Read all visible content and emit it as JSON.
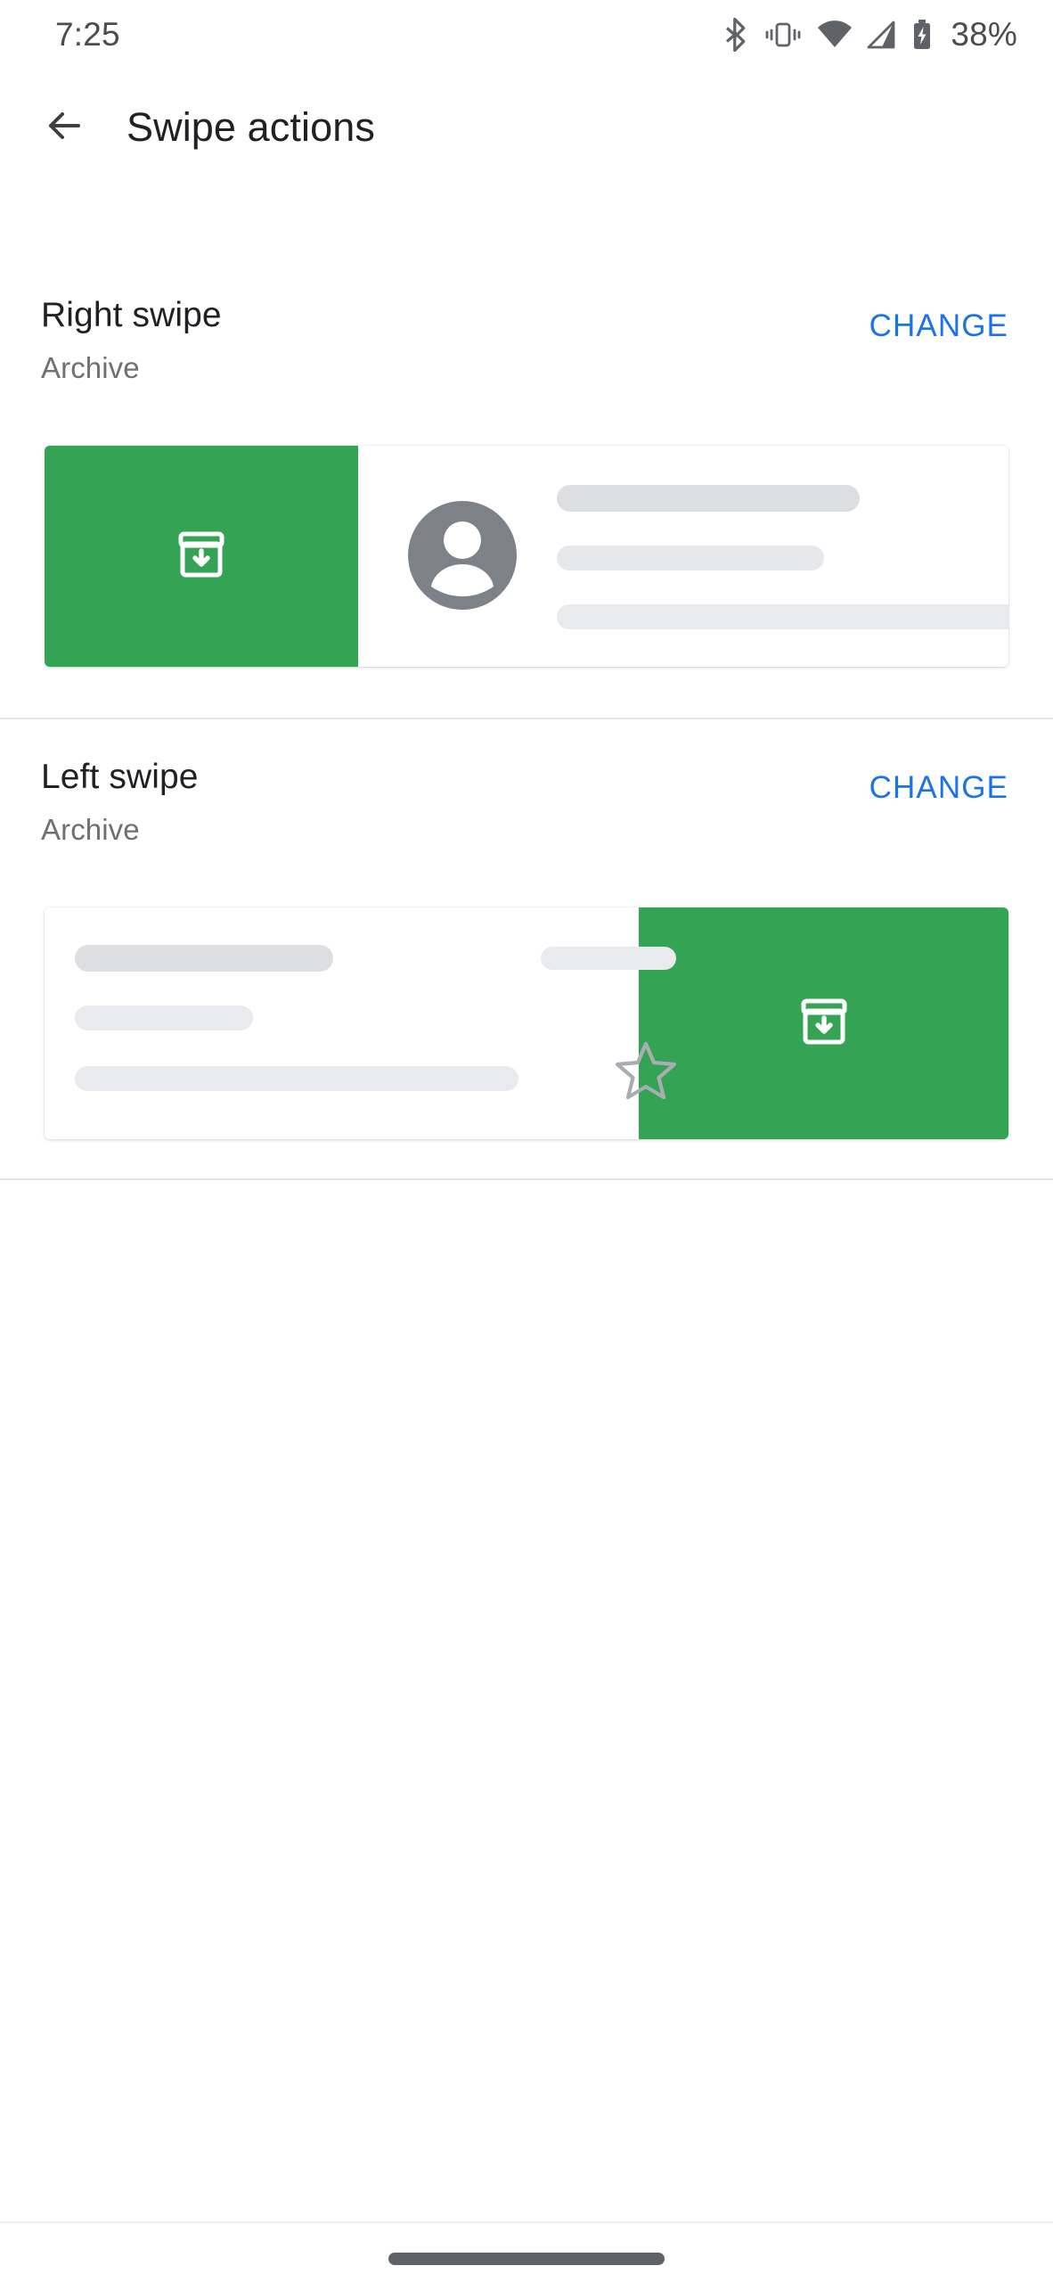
{
  "status_bar": {
    "time": "7:25",
    "battery_percent": "38%",
    "icons": [
      "bluetooth-icon",
      "vibrate-icon",
      "wifi-icon",
      "cell-signal-icon",
      "battery-charging-icon"
    ]
  },
  "app_bar": {
    "back_icon": "back-arrow-icon",
    "title": "Swipe actions"
  },
  "sections": [
    {
      "title": "Right swipe",
      "subtitle": "Archive",
      "change_label": "CHANGE",
      "action_icon": "archive-icon",
      "action_color": "#34a353",
      "direction": "right"
    },
    {
      "title": "Left swipe",
      "subtitle": "Archive",
      "change_label": "CHANGE",
      "action_icon": "archive-icon",
      "action_color": "#34a353",
      "direction": "left"
    }
  ],
  "preview_right": {
    "avatar_icon": "person-avatar-icon",
    "placeholder_bars": [
      "sender-line",
      "subject-line",
      "snippet-line"
    ]
  },
  "preview_left": {
    "star_icon": "star-outline-icon",
    "placeholder_bars": [
      "sender-line",
      "timestamp-line",
      "subject-line",
      "snippet-line"
    ]
  },
  "colors": {
    "accent_blue": "#1a73e8",
    "archive_green": "#34a353",
    "title_text": "#202124",
    "subtitle_text": "#6d7174",
    "divider": "#e4e6e8"
  },
  "nav": {
    "gesture_handle": "home-gesture-pill"
  }
}
